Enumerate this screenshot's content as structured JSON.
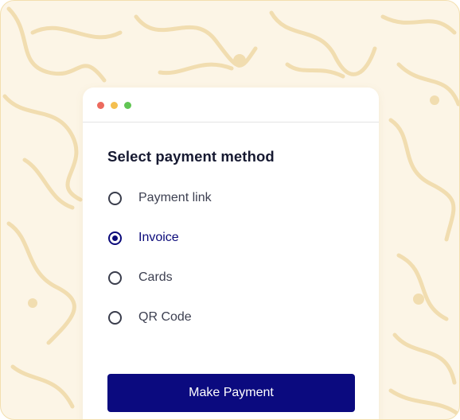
{
  "colors": {
    "background": "#FCF5E6",
    "pattern": "#F1DDB0",
    "accent": "#0B0A7F",
    "window_controls": [
      "#EC6A5E",
      "#F4BF4F",
      "#61C554"
    ]
  },
  "form": {
    "title": "Select payment method",
    "options": [
      {
        "label": "Payment link",
        "selected": false
      },
      {
        "label": "Invoice",
        "selected": true
      },
      {
        "label": "Cards",
        "selected": false
      },
      {
        "label": "QR Code",
        "selected": false
      }
    ],
    "submit_label": "Make Payment"
  },
  "icons": {
    "window_controls": [
      "close-dot",
      "minimize-dot",
      "maximize-dot"
    ]
  }
}
